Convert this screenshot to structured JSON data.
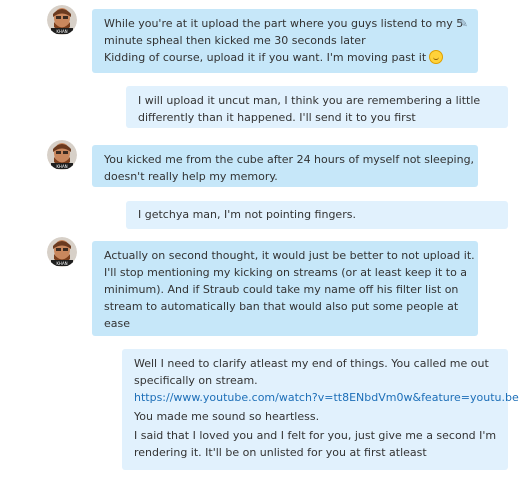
{
  "messages": [
    {
      "lines": [
        "While you're at it upload the part where you guys listend to my 5",
        "minute spheal then kicked me 30 seconds later"
      ],
      "lines2": [
        "Kidding of course, upload it if you want. I'm moving past it"
      ],
      "emoticon": "smile-emoticon",
      "edit_icon": "✎"
    },
    {
      "lines": [
        "I will upload it uncut man, I think you are remembering a little",
        "differently than it happened. I'll send it to you first"
      ]
    },
    {
      "lines": [
        "You kicked me from the cube after 24 hours of myself not sleeping,",
        "doesn't really help my memory."
      ]
    },
    {
      "lines": [
        "I getchya man, I'm not pointing fingers."
      ]
    },
    {
      "lines": [
        "Actually on second thought, it would just be better to not upload it.",
        "I'll stop mentioning my kicking on streams (or at least keep it to a",
        "minimum). And if Straub could take my name off his filter list on",
        "stream to automatically ban that would also put some people at",
        "ease"
      ]
    },
    {
      "lines": [
        "Well I need to clarify atleast my end of things. You called me out",
        "specifically on stream."
      ],
      "link": "https://www.youtube.com/watch?v=tt8ENbdVm0w&feature=youtu.be",
      "lines2": [
        "You made me sound so heartless."
      ],
      "lines3": [
        "I said that I loved you and I felt for you, just give me a second I'm",
        "rendering it. It'll be on unlisted for you at first atleast"
      ]
    }
  ],
  "colors": {
    "incoming_bubble": "#c6e7f9",
    "outgoing_bubble": "#e1f1fd",
    "link": "#1d6fb8"
  }
}
